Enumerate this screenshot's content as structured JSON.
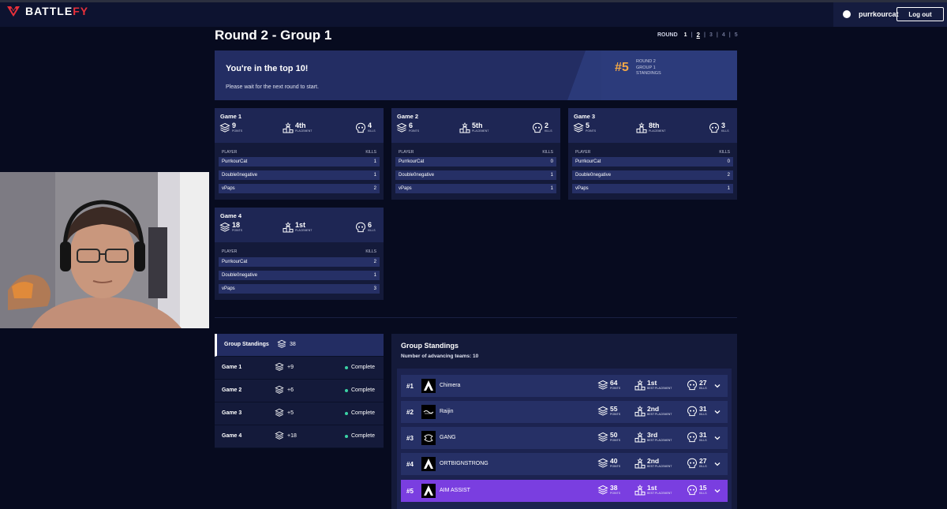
{
  "app": {
    "brand_main": "BATTLE",
    "brand_accent": "FY",
    "user": "purrkourcat",
    "logout_label": "Log out",
    "accent_red": "#e8303a"
  },
  "page": {
    "title": "Round 2 - Group 1"
  },
  "rounds": {
    "label": "ROUND",
    "items": [
      "1",
      "2",
      "3",
      "4",
      "5"
    ],
    "current": "2"
  },
  "banner": {
    "headline": "You're in the top 10!",
    "message": "Please wait for the next round to start.",
    "rank": "#5",
    "info_line1": "ROUND 2",
    "info_line2": "GROUP 1",
    "info_line3": "STANDINGS",
    "rank_color": "#f3a847"
  },
  "labels": {
    "points": "POINTS",
    "placement": "PLACEMENT",
    "kills": "KILLS",
    "player": "PLAYER",
    "kills_header": "KILLS",
    "best_placement": "BEST PLACEMENT"
  },
  "games": [
    {
      "name": "Game 1",
      "points": "9",
      "placement": "4th",
      "kills": "4",
      "players": [
        {
          "name": "PurrkourCat",
          "kills": "1"
        },
        {
          "name": "Double0negative",
          "kills": "1"
        },
        {
          "name": "vPaps",
          "kills": "2"
        }
      ]
    },
    {
      "name": "Game 2",
      "points": "6",
      "placement": "5th",
      "kills": "2",
      "players": [
        {
          "name": "PurrkourCat",
          "kills": "0"
        },
        {
          "name": "Double0negative",
          "kills": "1"
        },
        {
          "name": "vPaps",
          "kills": "1"
        }
      ]
    },
    {
      "name": "Game 3",
      "points": "5",
      "placement": "8th",
      "kills": "3",
      "players": [
        {
          "name": "PurrkourCat",
          "kills": "0"
        },
        {
          "name": "Double0negative",
          "kills": "2"
        },
        {
          "name": "vPaps",
          "kills": "1"
        }
      ]
    },
    {
      "name": "Game 4",
      "points": "18",
      "placement": "1st",
      "kills": "6",
      "players": [
        {
          "name": "PurrkourCat",
          "kills": "2"
        },
        {
          "name": "Double0negative",
          "kills": "1"
        },
        {
          "name": "vPaps",
          "kills": "3"
        }
      ]
    }
  ],
  "menu": [
    {
      "label": "Group Standings",
      "points": "38",
      "status": ""
    },
    {
      "label": "Game 1",
      "points": "+9",
      "status": "Complete"
    },
    {
      "label": "Game 2",
      "points": "+6",
      "status": "Complete"
    },
    {
      "label": "Game 3",
      "points": "+5",
      "status": "Complete"
    },
    {
      "label": "Game 4",
      "points": "+18",
      "status": "Complete"
    }
  ],
  "standings": {
    "title": "Group Standings",
    "advancing": "Number of advancing teams: 10",
    "highlight_color": "#7a3ee0",
    "teams": [
      {
        "rank": "#1",
        "name": "Chimera",
        "logo": "apex-logo-icon",
        "points": "64",
        "best": "1st",
        "kills": "27"
      },
      {
        "rank": "#2",
        "name": "Raijin",
        "logo": "raijin-logo-icon",
        "points": "55",
        "best": "2nd",
        "kills": "31"
      },
      {
        "rank": "#3",
        "name": "GANG",
        "logo": "gang-logo-icon",
        "points": "50",
        "best": "3rd",
        "kills": "31"
      },
      {
        "rank": "#4",
        "name": "ORTBIGNSTRONG",
        "logo": "apex-logo-icon",
        "points": "40",
        "best": "2nd",
        "kills": "27"
      },
      {
        "rank": "#5",
        "name": "AIM ASSIST",
        "logo": "apex-logo-icon",
        "points": "38",
        "best": "1st",
        "kills": "15"
      }
    ]
  }
}
